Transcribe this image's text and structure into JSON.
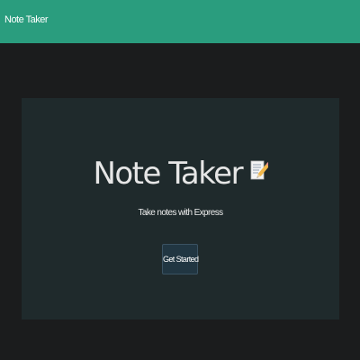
{
  "navbar": {
    "brand": "Note Taker",
    "color": "#2a9d7e"
  },
  "hero": {
    "title": "Note Taker",
    "title_icon": "memo-pencil-icon",
    "subtitle": "Take notes with Express",
    "cta_label": "Get Started"
  }
}
